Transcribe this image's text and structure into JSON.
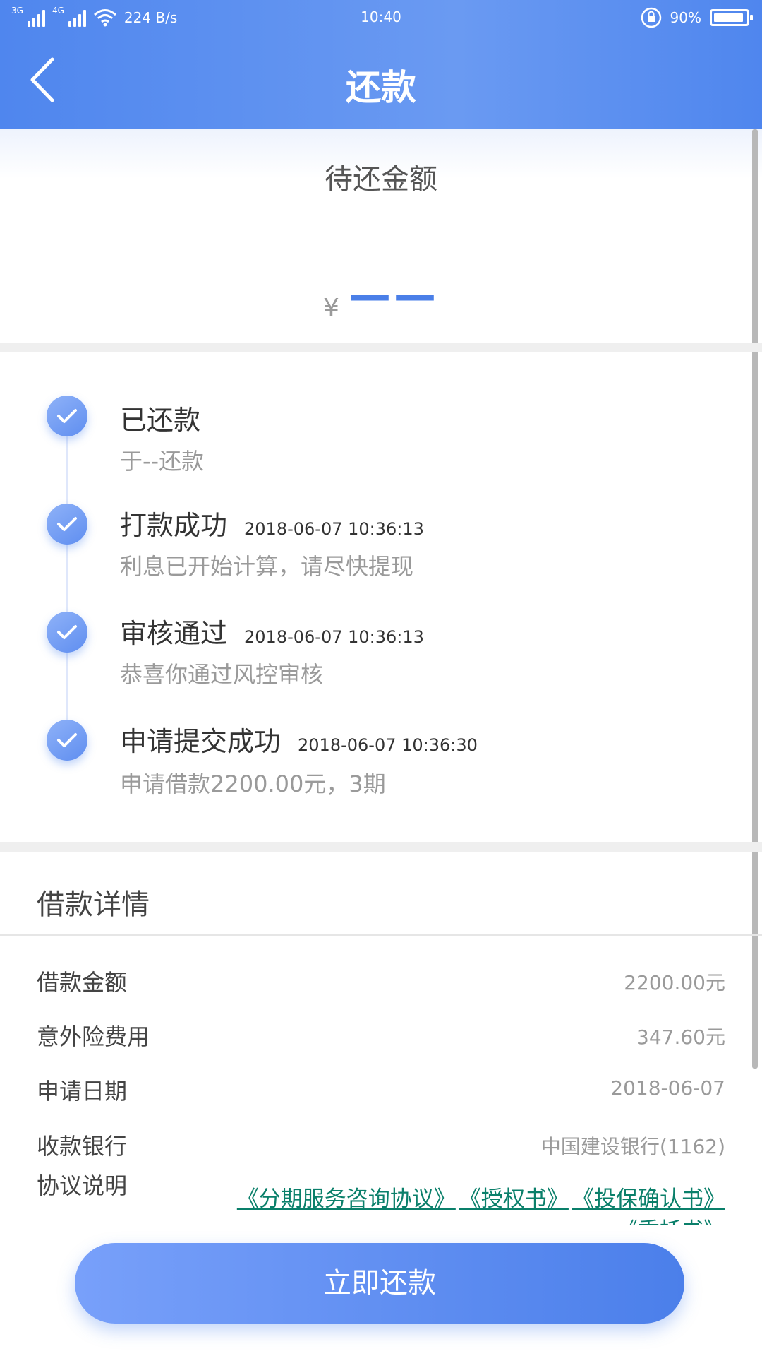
{
  "status_bar": {
    "net1": "3G",
    "net2": "4G",
    "speed": "224 B/s",
    "time": "10:40",
    "battery": "90%"
  },
  "header": {
    "title": "还款"
  },
  "amount": {
    "label": "待还金额",
    "currency": "¥",
    "value": "——"
  },
  "timeline": [
    {
      "title": "已还款",
      "time": "",
      "desc": "于--还款"
    },
    {
      "title": "打款成功",
      "time": "2018-06-07 10:36:13",
      "desc": "利息已开始计算，请尽快提现"
    },
    {
      "title": "审核通过",
      "time": "2018-06-07 10:36:13",
      "desc": "恭喜你通过风控审核"
    },
    {
      "title": "申请提交成功",
      "time": "2018-06-07 10:36:30",
      "desc": "申请借款2200.00元，3期"
    }
  ],
  "details": {
    "title": "借款详情",
    "rows": [
      {
        "label": "借款金额",
        "value": "2200.00元"
      },
      {
        "label": "意外险费用",
        "value": "347.60元"
      },
      {
        "label": "申请日期",
        "value": "2018-06-07"
      },
      {
        "label": "收款银行",
        "value": "中国建设银行(1162)"
      }
    ],
    "agreement_label": "协议说明",
    "agreements": [
      "《分期服务咨询协议》",
      "《授权书》",
      "《投保确认书》",
      "《委托书》"
    ]
  },
  "button": {
    "label": "立即还款"
  },
  "colors": {
    "primary": "#4f86ee",
    "link": "#0a7f6a"
  }
}
